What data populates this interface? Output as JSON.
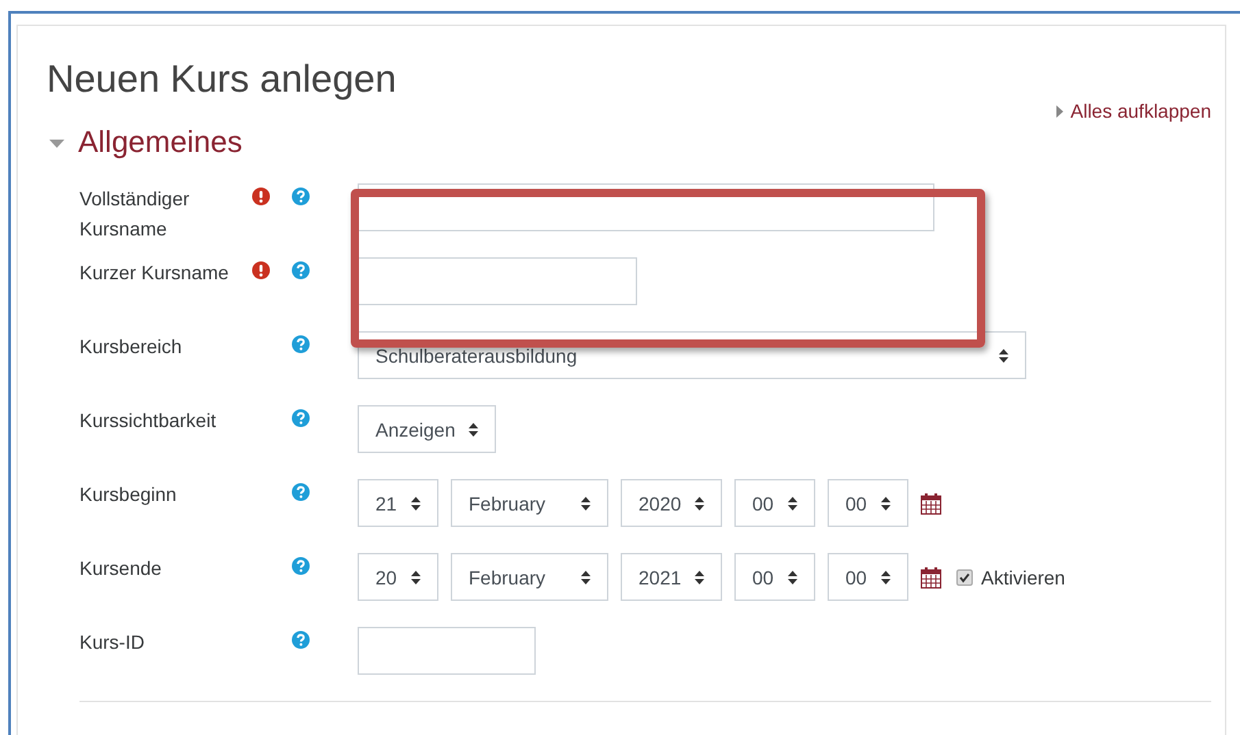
{
  "page_title": "Neuen Kurs anlegen",
  "expand_all": {
    "label": "Alles aufklappen"
  },
  "section": {
    "title": "Allgemeines",
    "expanded": true
  },
  "fields": [
    {
      "label": "Vollständiger Kursname",
      "required": true,
      "kind": "text"
    },
    {
      "label": "Kurzer Kursname",
      "required": true,
      "kind": "text"
    },
    {
      "label": "Kursbereich",
      "required": false,
      "kind": "select",
      "value": "Schulberaterausbildung"
    },
    {
      "label": "Kurssichtbarkeit",
      "required": false,
      "kind": "select",
      "value": "Anzeigen"
    },
    {
      "label": "Kursbeginn",
      "required": false,
      "kind": "date",
      "parts": [
        {
          "kind": "day",
          "value": "21"
        },
        {
          "kind": "month",
          "value": "February"
        },
        {
          "kind": "year",
          "value": "2020"
        },
        {
          "kind": "hour",
          "value": "00"
        },
        {
          "kind": "minute",
          "value": "00"
        }
      ]
    },
    {
      "label": "Kursende",
      "required": false,
      "kind": "date",
      "parts": [
        {
          "kind": "day",
          "value": "20"
        },
        {
          "kind": "month",
          "value": "February"
        },
        {
          "kind": "year",
          "value": "2021"
        },
        {
          "kind": "hour",
          "value": "00"
        },
        {
          "kind": "minute",
          "value": "00"
        }
      ],
      "enable": {
        "label": "Aktivieren",
        "checked": true
      }
    },
    {
      "label": "Kurs-ID",
      "required": false,
      "kind": "text"
    }
  ]
}
